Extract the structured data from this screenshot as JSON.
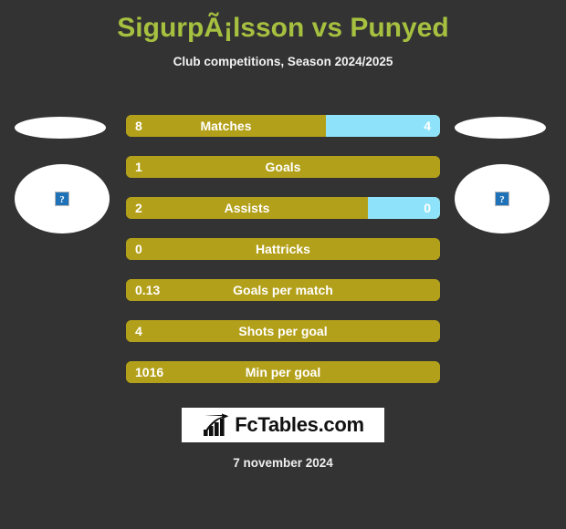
{
  "header": {
    "title": "SigurpÃ¡lsson vs Punyed",
    "subtitle": "Club competitions, Season 2024/2025"
  },
  "teams": {
    "left": {
      "flag_placeholder": "broken-image",
      "crest_placeholder": "?"
    },
    "right": {
      "flag_placeholder": "broken-image",
      "crest_placeholder": "?"
    }
  },
  "colors": {
    "background": "#333333",
    "title": "#A6C03F",
    "bar_left": "#B3A01A",
    "bar_right": "#8EE3FB",
    "text": "#FFFFFF"
  },
  "chart_data": {
    "type": "bar",
    "title": "SigurpÃ¡lsson vs Punyed",
    "subtitle": "Club competitions, Season 2024/2025",
    "orientation": "horizontal-split",
    "categories": [
      "Matches",
      "Goals",
      "Assists",
      "Hattricks",
      "Goals per match",
      "Shots per goal",
      "Min per goal"
    ],
    "series": [
      {
        "name": "SigurpÃ¡lsson",
        "color": "#B3A01A",
        "values": [
          8,
          1,
          2,
          0,
          0.13,
          4,
          1016
        ]
      },
      {
        "name": "Punyed",
        "color": "#8EE3FB",
        "values": [
          4,
          null,
          0,
          null,
          null,
          null,
          null
        ]
      }
    ],
    "rows": [
      {
        "label": "Matches",
        "left_value": "8",
        "right_value": "4",
        "left_fraction": 0.636
      },
      {
        "label": "Goals",
        "left_value": "1",
        "right_value": "",
        "left_fraction": 1.0
      },
      {
        "label": "Assists",
        "left_value": "2",
        "right_value": "0",
        "left_fraction": 0.771
      },
      {
        "label": "Hattricks",
        "left_value": "0",
        "right_value": "",
        "left_fraction": 1.0
      },
      {
        "label": "Goals per match",
        "left_value": "0.13",
        "right_value": "",
        "left_fraction": 1.0
      },
      {
        "label": "Shots per goal",
        "left_value": "4",
        "right_value": "",
        "left_fraction": 1.0
      },
      {
        "label": "Min per goal",
        "left_value": "1016",
        "right_value": "",
        "left_fraction": 1.0
      }
    ]
  },
  "footer": {
    "logo_text": "FcTables.com",
    "logo_icon": "bar-chart-arrow-icon",
    "date": "7 november 2024"
  }
}
